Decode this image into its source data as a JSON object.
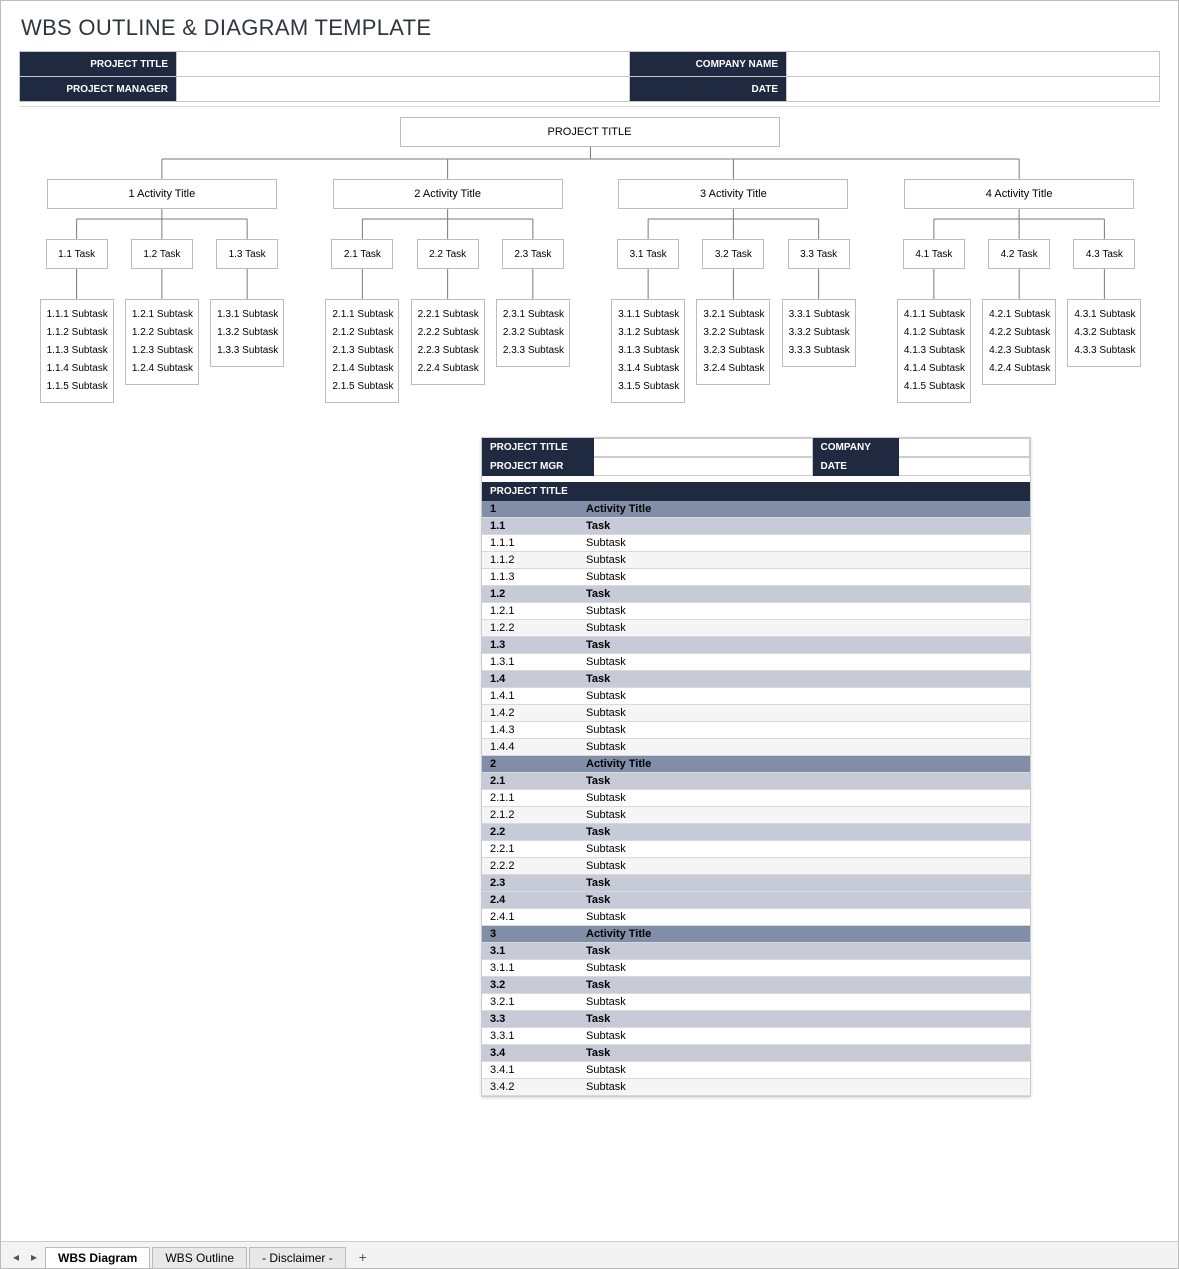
{
  "doc_title": "WBS OUTLINE & DIAGRAM TEMPLATE",
  "header": {
    "project_title_label": "PROJECT TITLE",
    "project_manager_label": "PROJECT MANAGER",
    "company_name_label": "COMPANY NAME",
    "date_label": "DATE",
    "project_title": "",
    "project_manager": "",
    "company_name": "",
    "date": ""
  },
  "tree": {
    "root": "PROJECT TITLE",
    "activities": [
      {
        "label": "1 Activity Title",
        "tasks": [
          {
            "label": "1.1 Task",
            "subs": [
              "1.1.1 Subtask",
              "1.1.2 Subtask",
              "1.1.3 Subtask",
              "1.1.4 Subtask",
              "1.1.5 Subtask"
            ]
          },
          {
            "label": "1.2 Task",
            "subs": [
              "1.2.1 Subtask",
              "1.2.2 Subtask",
              "1.2.3 Subtask",
              "1.2.4 Subtask"
            ]
          },
          {
            "label": "1.3 Task",
            "subs": [
              "1.3.1 Subtask",
              "1.3.2 Subtask",
              "1.3.3 Subtask"
            ]
          }
        ]
      },
      {
        "label": "2 Activity Title",
        "tasks": [
          {
            "label": "2.1 Task",
            "subs": [
              "2.1.1 Subtask",
              "2.1.2 Subtask",
              "2.1.3 Subtask",
              "2.1.4 Subtask",
              "2.1.5 Subtask"
            ]
          },
          {
            "label": "2.2 Task",
            "subs": [
              "2.2.1 Subtask",
              "2.2.2 Subtask",
              "2.2.3 Subtask",
              "2.2.4 Subtask"
            ]
          },
          {
            "label": "2.3 Task",
            "subs": [
              "2.3.1 Subtask",
              "2.3.2 Subtask",
              "2.3.3 Subtask"
            ]
          }
        ]
      },
      {
        "label": "3 Activity Title",
        "tasks": [
          {
            "label": "3.1 Task",
            "subs": [
              "3.1.1 Subtask",
              "3.1.2 Subtask",
              "3.1.3 Subtask",
              "3.1.4 Subtask",
              "3.1.5 Subtask"
            ]
          },
          {
            "label": "3.2 Task",
            "subs": [
              "3.2.1 Subtask",
              "3.2.2 Subtask",
              "3.2.3 Subtask",
              "3.2.4 Subtask"
            ]
          },
          {
            "label": "3.3 Task",
            "subs": [
              "3.3.1 Subtask",
              "3.3.2 Subtask",
              "3.3.3 Subtask"
            ]
          }
        ]
      },
      {
        "label": "4 Activity Title",
        "tasks": [
          {
            "label": "4.1 Task",
            "subs": [
              "4.1.1 Subtask",
              "4.1.2 Subtask",
              "4.1.3 Subtask",
              "4.1.4 Subtask",
              "4.1.5 Subtask"
            ]
          },
          {
            "label": "4.2 Task",
            "subs": [
              "4.2.1 Subtask",
              "4.2.2 Subtask",
              "4.2.3 Subtask",
              "4.2.4 Subtask"
            ]
          },
          {
            "label": "4.3 Task",
            "subs": [
              "4.3.1 Subtask",
              "4.3.2 Subtask",
              "4.3.3 Subtask"
            ]
          }
        ]
      }
    ]
  },
  "panel": {
    "labels": {
      "project_title": "PROJECT TITLE",
      "project_mgr": "PROJECT MGR",
      "company": "COMPANY",
      "date": "DATE"
    },
    "title_row": "PROJECT TITLE"
  },
  "outline_rows": [
    {
      "num": "1",
      "name": "Activity Title",
      "level": "at"
    },
    {
      "num": "1.1",
      "name": "Task",
      "level": "tk"
    },
    {
      "num": "1.1.1",
      "name": "Subtask",
      "level": "sub"
    },
    {
      "num": "1.1.2",
      "name": "Subtask",
      "level": "sub"
    },
    {
      "num": "1.1.3",
      "name": "Subtask",
      "level": "sub"
    },
    {
      "num": "1.2",
      "name": "Task",
      "level": "tk"
    },
    {
      "num": "1.2.1",
      "name": "Subtask",
      "level": "sub"
    },
    {
      "num": "1.2.2",
      "name": "Subtask",
      "level": "sub"
    },
    {
      "num": "1.3",
      "name": "Task",
      "level": "tk"
    },
    {
      "num": "1.3.1",
      "name": "Subtask",
      "level": "sub"
    },
    {
      "num": "1.4",
      "name": "Task",
      "level": "tk"
    },
    {
      "num": "1.4.1",
      "name": "Subtask",
      "level": "sub"
    },
    {
      "num": "1.4.2",
      "name": "Subtask",
      "level": "sub"
    },
    {
      "num": "1.4.3",
      "name": "Subtask",
      "level": "sub"
    },
    {
      "num": "1.4.4",
      "name": "Subtask",
      "level": "sub"
    },
    {
      "num": "2",
      "name": "Activity Title",
      "level": "at"
    },
    {
      "num": "2.1",
      "name": "Task",
      "level": "tk"
    },
    {
      "num": "2.1.1",
      "name": "Subtask",
      "level": "sub"
    },
    {
      "num": "2.1.2",
      "name": "Subtask",
      "level": "sub"
    },
    {
      "num": "2.2",
      "name": "Task",
      "level": "tk"
    },
    {
      "num": "2.2.1",
      "name": "Subtask",
      "level": "sub"
    },
    {
      "num": "2.2.2",
      "name": "Subtask",
      "level": "sub"
    },
    {
      "num": "2.3",
      "name": "Task",
      "level": "tk"
    },
    {
      "num": "2.4",
      "name": "Task",
      "level": "tk"
    },
    {
      "num": "2.4.1",
      "name": "Subtask",
      "level": "sub"
    },
    {
      "num": "3",
      "name": "Activity Title",
      "level": "at"
    },
    {
      "num": "3.1",
      "name": "Task",
      "level": "tk"
    },
    {
      "num": "3.1.1",
      "name": "Subtask",
      "level": "sub"
    },
    {
      "num": "3.2",
      "name": "Task",
      "level": "tk"
    },
    {
      "num": "3.2.1",
      "name": "Subtask",
      "level": "sub"
    },
    {
      "num": "3.3",
      "name": "Task",
      "level": "tk"
    },
    {
      "num": "3.3.1",
      "name": "Subtask",
      "level": "sub"
    },
    {
      "num": "3.4",
      "name": "Task",
      "level": "tk"
    },
    {
      "num": "3.4.1",
      "name": "Subtask",
      "level": "sub"
    },
    {
      "num": "3.4.2",
      "name": "Subtask",
      "level": "sub"
    }
  ],
  "tabs": {
    "items": [
      {
        "label": "WBS Diagram",
        "active": true
      },
      {
        "label": "WBS Outline",
        "active": false
      },
      {
        "label": "- Disclaimer -",
        "active": false
      }
    ],
    "plus": "+"
  }
}
